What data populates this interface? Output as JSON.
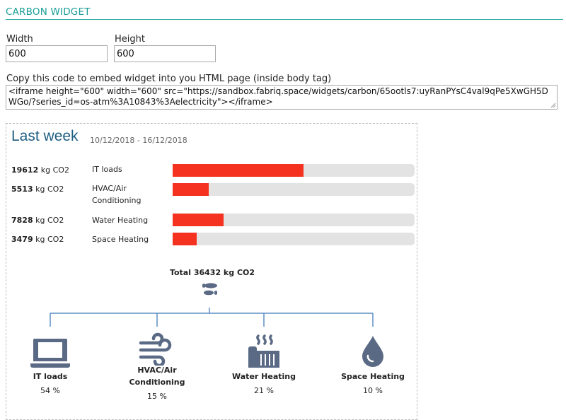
{
  "header": {
    "title": "CARBON WIDGET"
  },
  "form": {
    "width_label": "Width",
    "width_value": "600",
    "height_label": "Height",
    "height_value": "600",
    "embed_label": "Copy this code to embed widget into you HTML page (inside body tag)",
    "embed_code": "<iframe height=\"600\" width=\"600\" src=\"https://sandbox.fabriq.space/widgets/carbon/65ootls7:uyRanPYsC4val9qPe5XwGH5DWGo/?series_id=os-atm%3A10843%3Aelectricity\"></iframe>"
  },
  "widget": {
    "title": "Last week",
    "date_range": "10/12/2018 - 16/12/2018",
    "unit": "kg CO2",
    "rows": [
      {
        "value": "19612",
        "name": "IT loads",
        "fill": 0.54
      },
      {
        "value": "5513",
        "name": "HVAC/Air Conditioning",
        "fill": 0.15
      },
      {
        "value": "7828",
        "name": "Water Heating",
        "fill": 0.21
      },
      {
        "value": "3479",
        "name": "Space Heating",
        "fill": 0.1
      }
    ],
    "total_text": "Total 36432 kg CO2",
    "categories": [
      {
        "name": "IT loads",
        "pct": "54 %",
        "icon": "laptop-icon"
      },
      {
        "name": "HVAC/Air Conditioning",
        "pct": "15 %",
        "icon": "wind-icon"
      },
      {
        "name": "Water Heating",
        "pct": "21 %",
        "icon": "water-heater-icon"
      },
      {
        "name": "Space Heating",
        "pct": "10 %",
        "icon": "drop-icon"
      }
    ],
    "colors": {
      "bar": "#f4321f",
      "track": "#e3e3e3",
      "icon": "#5a6a85",
      "tree": "#5b8fc4",
      "title": "#1e5e82"
    }
  }
}
